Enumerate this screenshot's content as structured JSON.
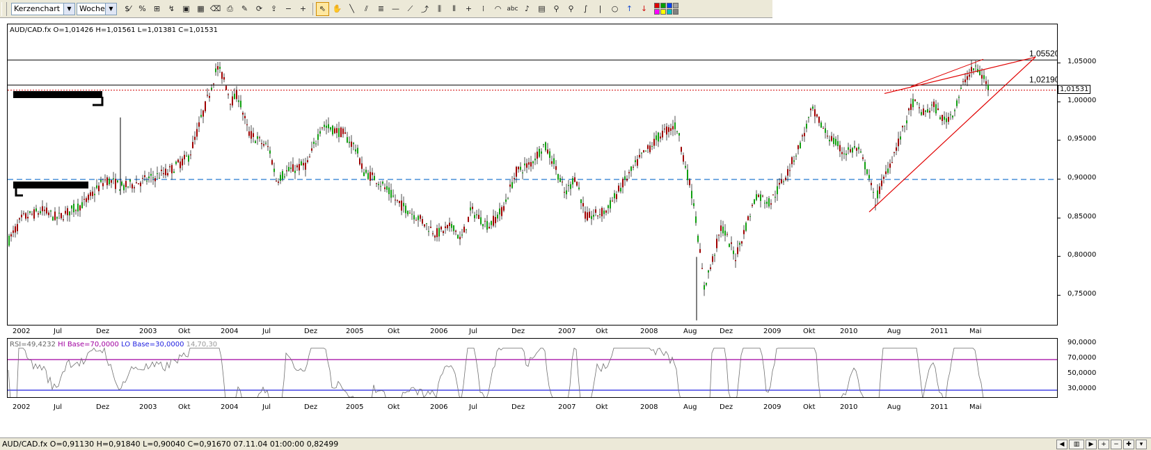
{
  "toolbar": {
    "chart_type": "Kerzenchart",
    "timeframe": "Woche",
    "tools": [
      {
        "name": "percent-change-icon",
        "glyph": "$⁄"
      },
      {
        "name": "percent-icon",
        "glyph": "%"
      },
      {
        "name": "bar-chart-icon",
        "glyph": "⊞"
      },
      {
        "name": "indicator-icon",
        "glyph": "↯"
      },
      {
        "name": "screen-icon",
        "glyph": "▣"
      },
      {
        "name": "image-icon",
        "glyph": "▦"
      },
      {
        "name": "eraser-icon",
        "glyph": "⌫"
      },
      {
        "name": "print-icon",
        "glyph": "⎙"
      },
      {
        "name": "edit-icon",
        "glyph": "✎"
      },
      {
        "name": "refresh-icon",
        "glyph": "⟳"
      },
      {
        "name": "export-icon",
        "glyph": "⇪"
      },
      {
        "name": "zoom-out-icon",
        "glyph": "−"
      },
      {
        "name": "zoom-in-icon",
        "glyph": "+"
      }
    ],
    "draw_tools": [
      {
        "name": "cursor-icon",
        "glyph": "⇖",
        "active": true
      },
      {
        "name": "hand-icon",
        "glyph": "✋"
      },
      {
        "name": "line-icon",
        "glyph": "╲"
      },
      {
        "name": "parallel-lines-icon",
        "glyph": "⫽"
      },
      {
        "name": "channel-icon",
        "glyph": "≣"
      },
      {
        "name": "horizontal-line-icon",
        "glyph": "—"
      },
      {
        "name": "fan-icon",
        "glyph": "⟋"
      },
      {
        "name": "fibonacci-icon",
        "glyph": "⤴"
      },
      {
        "name": "fibonacci-retracement-icon",
        "glyph": "⫼"
      },
      {
        "name": "vertical-lines-icon",
        "glyph": "⦀"
      },
      {
        "name": "crosshair-icon",
        "glyph": "+"
      },
      {
        "name": "cycle-lines-icon",
        "glyph": "⁞"
      },
      {
        "name": "arc-icon",
        "glyph": "◠"
      },
      {
        "name": "text-tool-icon",
        "glyph": "abc"
      },
      {
        "name": "bell-icon",
        "glyph": "♪"
      },
      {
        "name": "calculator-icon",
        "glyph": "▤"
      },
      {
        "name": "magnifier-icon",
        "glyph": "⚲"
      },
      {
        "name": "zoom-tool-icon",
        "glyph": "⚲"
      },
      {
        "name": "freehand-icon",
        "glyph": "∫"
      },
      {
        "name": "vertical-bar-icon",
        "glyph": "|"
      },
      {
        "name": "circle-icon",
        "glyph": "○"
      },
      {
        "name": "arrow-up-icon",
        "glyph": "↑",
        "color": "#1c4fd0"
      },
      {
        "name": "arrow-down-icon",
        "glyph": "↓",
        "color": "#d01010"
      }
    ],
    "palette": [
      "#e00000",
      "#00a000",
      "#0040ff",
      "#a0a0a0",
      "#ff00ff",
      "#ffff00",
      "#00c0c0",
      "#808080"
    ]
  },
  "chart": {
    "info": "AUD/CAD.fx O=1,01426 H=1,01561 L=1,01381 C=1,01531",
    "price_labels": [
      "1,05520",
      "1,02190"
    ],
    "current_price": "1,01531",
    "y_ticks": [
      "1,05000",
      "1,00000",
      "0,95000",
      "0,90000",
      "0,85000",
      "0,80000",
      "0,75000"
    ],
    "x_ticks": [
      "2002",
      "Jul",
      "Dez",
      "2003",
      "Okt",
      "2004",
      "Jul",
      "Dez",
      "2005",
      "Okt",
      "2006",
      "Jul",
      "Dez",
      "2007",
      "Okt",
      "2008",
      "Aug",
      "Dez",
      "2009",
      "Okt",
      "2010",
      "Aug",
      "2011",
      "Mai"
    ],
    "colors": {
      "bull": "#10a010",
      "bear": "#a00000",
      "trend": "#e00000",
      "dashed": "#4a90d8",
      "dotted": "#d00000"
    }
  },
  "rsi": {
    "info": "RSI=49,4232",
    "hi": "HI Base=70,0000",
    "lo": "LO Base=30,0000",
    "params": "14,70,30",
    "y_ticks": [
      "90,0000",
      "70,0000",
      "50,0000",
      "30,0000"
    ],
    "x_ticks": [
      "2002",
      "Jul",
      "Dez",
      "2003",
      "Okt",
      "2004",
      "Jul",
      "Dez",
      "2005",
      "Okt",
      "2006",
      "Jul",
      "Dez",
      "2007",
      "Okt",
      "2008",
      "Aug",
      "Dez",
      "2009",
      "Okt",
      "2010",
      "Aug",
      "2011",
      "Mai"
    ],
    "colors": {
      "hi": "#a000a0",
      "lo": "#2020e0",
      "line": "#707070"
    }
  },
  "status": {
    "text": "AUD/CAD.fx O=0,91130 H=0,91840 L=0,90040 C=0,91670   07.11.04 01:00:00 0,82499"
  }
}
